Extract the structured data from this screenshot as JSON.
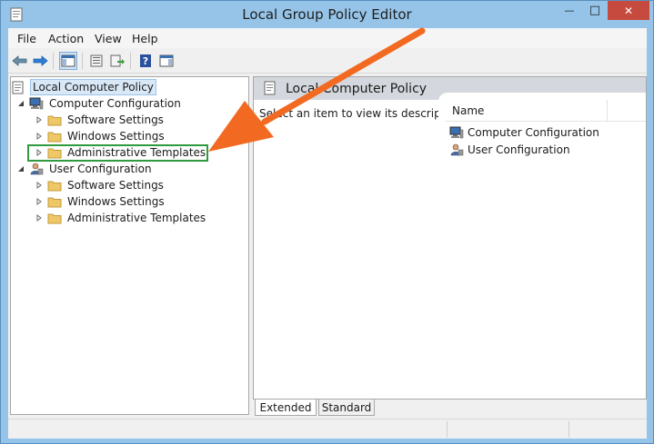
{
  "window": {
    "title": "Local Group Policy Editor",
    "minimize_glyph": "—",
    "maximize_glyph": "□",
    "close_glyph": "✕"
  },
  "menu": {
    "items": [
      "File",
      "Action",
      "View",
      "Help"
    ]
  },
  "toolbar": {
    "icons": [
      "back-arrow-icon",
      "forward-arrow-icon",
      "show-hide-console-tree-icon",
      "properties-icon",
      "export-list-icon",
      "help-icon",
      "show-hide-action-pane-icon"
    ]
  },
  "tree": {
    "root": "Local Computer Policy",
    "computer_configuration": "Computer Configuration",
    "user_configuration": "User Configuration",
    "cc_software_settings": "Software Settings",
    "cc_windows_settings": "Windows Settings",
    "cc_administrative_templates": "Administrative Templates",
    "uc_software_settings": "Software Settings",
    "uc_windows_settings": "Windows Settings",
    "uc_administrative_templates": "Administrative Templates"
  },
  "details": {
    "header_title": "Local Computer Policy",
    "description": "Select an item to view its description.",
    "column_name": "Name",
    "rows": [
      "Computer Configuration",
      "User Configuration"
    ]
  },
  "tabs": [
    "Extended",
    "Standard"
  ],
  "colors": {
    "annotation_arrow": "#f26a21",
    "highlight_box": "#2f9a3f",
    "title_bar": "#95c4e8",
    "close_button": "#c74a3f"
  }
}
